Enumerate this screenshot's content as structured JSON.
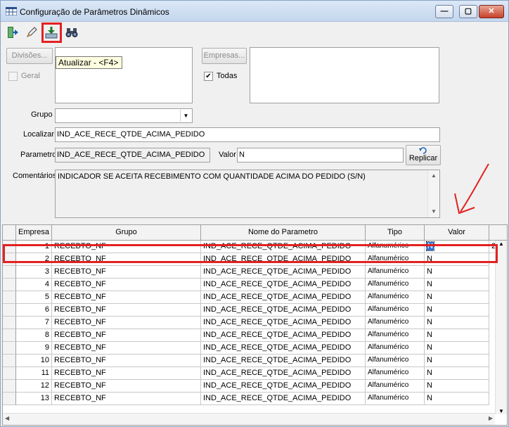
{
  "window": {
    "title": "Configuração de Parâmetros Dinâmicos"
  },
  "toolbar": {
    "tooltip": "Atualizar - <F4>"
  },
  "filters": {
    "divisoes_button": "Divisões...",
    "geral_label": "Geral",
    "empresas_button": "Empresas...",
    "todas_label": "Todas",
    "todas_checked": "✔",
    "grupo_label": "Grupo",
    "grupo_value": "",
    "localizar_label": "Localizar",
    "localizar_value": "IND_ACE_RECE_QTDE_ACIMA_PEDIDO",
    "parametro_label": "Parametro",
    "parametro_value": "IND_ACE_RECE_QTDE_ACIMA_PEDIDO",
    "valor_label": "Valor",
    "valor_value": "N",
    "replicar_button": "Replicar",
    "comentarios_label": "Comentários",
    "comentarios_value": "INDICADOR SE ACEITA RECEBIMENTO COM QUANTIDADE ACIMA DO PEDIDO (S/N)"
  },
  "grid": {
    "headers": [
      "Empresa",
      "Grupo",
      "Nome do Parametro",
      "Tipo",
      "Valor"
    ],
    "rows": [
      {
        "empresa": "1",
        "grupo": "RECEBTO_NF",
        "nome": "IND_ACE_RECE_QTDE_ACIMA_PEDIDO",
        "tipo": "Alfanumérico",
        "valor": "N",
        "extra": "2"
      },
      {
        "empresa": "2",
        "grupo": "RECEBTO_NF",
        "nome": "IND_ACE_RECE_QTDE_ACIMA_PEDIDO",
        "tipo": "Alfanumérico",
        "valor": "N"
      },
      {
        "empresa": "3",
        "grupo": "RECEBTO_NF",
        "nome": "IND_ACE_RECE_QTDE_ACIMA_PEDIDO",
        "tipo": "Alfanumérico",
        "valor": "N"
      },
      {
        "empresa": "4",
        "grupo": "RECEBTO_NF",
        "nome": "IND_ACE_RECE_QTDE_ACIMA_PEDIDO",
        "tipo": "Alfanumérico",
        "valor": "N"
      },
      {
        "empresa": "5",
        "grupo": "RECEBTO_NF",
        "nome": "IND_ACE_RECE_QTDE_ACIMA_PEDIDO",
        "tipo": "Alfanumérico",
        "valor": "N"
      },
      {
        "empresa": "6",
        "grupo": "RECEBTO_NF",
        "nome": "IND_ACE_RECE_QTDE_ACIMA_PEDIDO",
        "tipo": "Alfanumérico",
        "valor": "N"
      },
      {
        "empresa": "7",
        "grupo": "RECEBTO_NF",
        "nome": "IND_ACE_RECE_QTDE_ACIMA_PEDIDO",
        "tipo": "Alfanumérico",
        "valor": "N"
      },
      {
        "empresa": "8",
        "grupo": "RECEBTO_NF",
        "nome": "IND_ACE_RECE_QTDE_ACIMA_PEDIDO",
        "tipo": "Alfanumérico",
        "valor": "N"
      },
      {
        "empresa": "9",
        "grupo": "RECEBTO_NF",
        "nome": "IND_ACE_RECE_QTDE_ACIMA_PEDIDO",
        "tipo": "Alfanumérico",
        "valor": "N"
      },
      {
        "empresa": "10",
        "grupo": "RECEBTO_NF",
        "nome": "IND_ACE_RECE_QTDE_ACIMA_PEDIDO",
        "tipo": "Alfanumérico",
        "valor": "N"
      },
      {
        "empresa": "11",
        "grupo": "RECEBTO_NF",
        "nome": "IND_ACE_RECE_QTDE_ACIMA_PEDIDO",
        "tipo": "Alfanumérico",
        "valor": "N"
      },
      {
        "empresa": "12",
        "grupo": "RECEBTO_NF",
        "nome": "IND_ACE_RECE_QTDE_ACIMA_PEDIDO",
        "tipo": "Alfanumérico",
        "valor": "N"
      },
      {
        "empresa": "13",
        "grupo": "RECEBTO_NF",
        "nome": "IND_ACE_RECE_QTDE_ACIMA_PEDIDO",
        "tipo": "Alfanumérico",
        "valor": "N"
      }
    ]
  },
  "icons": {
    "app": "grid-app-icon",
    "exit": "exit-door-icon",
    "edit": "pencil-icon",
    "refresh": "download-tray-icon",
    "find": "binoculars-icon",
    "replicar": "undo-arrow-icon"
  },
  "colors": {
    "annotation": "#e32121",
    "selection": "#3375d6"
  }
}
